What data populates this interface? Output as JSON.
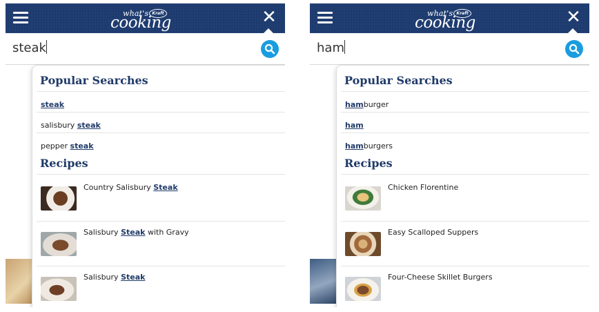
{
  "logo": {
    "small": "what's",
    "brand": "Kraft",
    "big": "cooking"
  },
  "left": {
    "query": "steak",
    "popular_title": "Popular Searches",
    "suggestions": [
      {
        "pre": "",
        "match": "steak",
        "post": ""
      },
      {
        "pre": "salisbury ",
        "match": "steak",
        "post": ""
      },
      {
        "pre": "pepper ",
        "match": "steak",
        "post": ""
      }
    ],
    "recipes_title": "Recipes",
    "recipes": [
      {
        "pre": "Country Salisbury ",
        "match": "Steak",
        "post": ""
      },
      {
        "pre": "Salisbury ",
        "match": "Steak",
        "post": " with Gravy"
      },
      {
        "pre": "Salisbury ",
        "match": "Steak",
        "post": ""
      }
    ]
  },
  "right": {
    "query": "ham",
    "popular_title": "Popular Searches",
    "suggestions": [
      {
        "pre": "",
        "match": "ham",
        "post": "burger"
      },
      {
        "pre": "",
        "match": "ham",
        "post": ""
      },
      {
        "pre": "",
        "match": "ham",
        "post": "burgers"
      }
    ],
    "recipes_title": "Recipes",
    "recipes": [
      {
        "pre": "Chicken Florentine",
        "match": "",
        "post": ""
      },
      {
        "pre": "Easy Scalloped Suppers",
        "match": "",
        "post": ""
      },
      {
        "pre": "Four-Cheese Skillet Burgers",
        "match": "",
        "post": ""
      }
    ]
  },
  "colors": {
    "header": "#1d3b6f",
    "accent": "#1a9de0",
    "title": "#1f3a68"
  },
  "icons": {
    "menu": "hamburger-menu-icon",
    "close": "close-icon",
    "search": "search-icon"
  }
}
